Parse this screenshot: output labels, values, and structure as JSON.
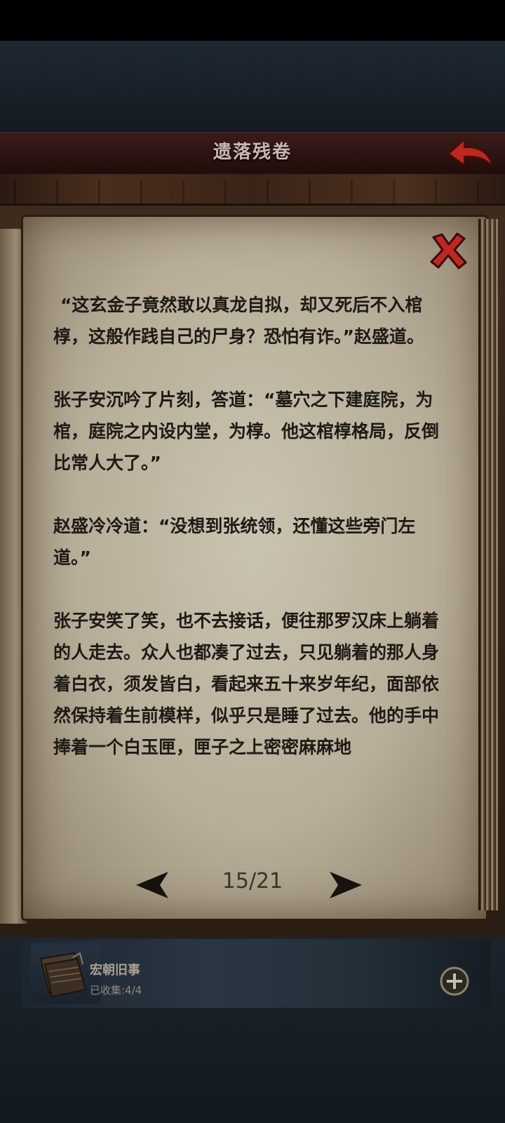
{
  "header": {
    "title": "遗落残卷",
    "back_icon": "back-arrow-icon"
  },
  "page": {
    "paragraphs": [
      "“这玄金子竟然敢以真龙自拟，却又死后不入棺椁，这般作践自己的尸身？恐怕有诈。”赵盛道。",
      "张子安沉吟了片刻，答道：“墓穴之下建庭院，为棺，庭院之内设内堂，为椁。他这棺椁格局，反倒比常人大了。”",
      "赵盛冷冷道：“没想到张统领，还懂这些旁门左道。”",
      "张子安笑了笑，也不去接话，便往那罗汉床上躺着的人走去。众人也都凑了过去，只见躺着的那人身着白衣，须发皆白，看起来五十来岁年纪，面部依然保持着生前模样，似乎只是睡了过去。他的手中捧着一个白玉匣，匣子之上密密麻麻地"
    ]
  },
  "pager": {
    "page_label": "15/21",
    "current": 15,
    "total": 21
  },
  "collection": {
    "name": "宏朝旧事",
    "count_label": "已收集:4/4",
    "collected": 4,
    "total": 4
  },
  "colors": {
    "accent_red": "#c0271f",
    "parchment": "#bdb39e",
    "ink": "#1e1a15"
  }
}
